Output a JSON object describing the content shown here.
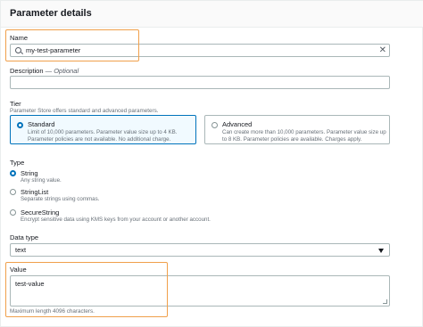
{
  "panel": {
    "title": "Parameter details"
  },
  "name": {
    "label": "Name",
    "value": "my-test-parameter"
  },
  "description": {
    "label": "Description",
    "optional": "— Optional",
    "value": ""
  },
  "tier": {
    "label": "Tier",
    "hint": "Parameter Store offers standard and advanced parameters.",
    "options": [
      {
        "title": "Standard",
        "desc1": "Limit of 10,000 parameters. Parameter value size up to 4 KB.",
        "desc2": "Parameter policies are not available. No additional charge.",
        "selected": true
      },
      {
        "title": "Advanced",
        "desc1": "Can create more than 10,000 parameters. Parameter value size up",
        "desc2": "to 8 KB. Parameter policies are available. Charges apply.",
        "selected": false
      }
    ]
  },
  "type": {
    "label": "Type",
    "options": [
      {
        "title": "String",
        "desc": "Any string value.",
        "selected": true
      },
      {
        "title": "StringList",
        "desc": "Separate strings using commas.",
        "selected": false
      },
      {
        "title": "SecureString",
        "desc": "Encrypt sensitive data using KMS keys from your account or another account.",
        "selected": false
      }
    ]
  },
  "data_type": {
    "label": "Data type",
    "value": "text"
  },
  "value": {
    "label": "Value",
    "value": "test-value",
    "hint": "Maximum length 4096 characters."
  },
  "colors": {
    "accent": "#0073bb",
    "highlight": "#f0a04b"
  }
}
